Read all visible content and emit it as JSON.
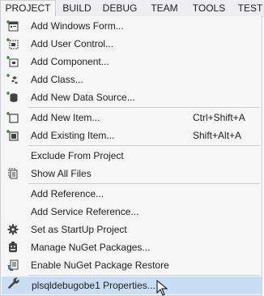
{
  "menubar": {
    "items": [
      "PROJECT",
      "BUILD",
      "DEBUG",
      "TEAM",
      "TOOLS",
      "TEST"
    ]
  },
  "menu": {
    "items": [
      {
        "label": "Add Windows Form...",
        "icon": "windows-form-icon"
      },
      {
        "label": "Add User Control...",
        "icon": "user-control-icon"
      },
      {
        "label": "Add Component...",
        "icon": "component-icon"
      },
      {
        "label": "Add Class...",
        "icon": "class-icon"
      },
      {
        "label": "Add New Data Source...",
        "icon": "data-source-icon"
      },
      {
        "label": "Add New Item...",
        "shortcut": "Ctrl+Shift+A",
        "icon": "new-item-icon"
      },
      {
        "label": "Add Existing Item...",
        "shortcut": "Shift+Alt+A",
        "icon": "existing-item-icon"
      },
      {
        "label": "Exclude From Project"
      },
      {
        "label": "Show All Files",
        "icon": "show-all-files-icon"
      },
      {
        "label": "Add Reference..."
      },
      {
        "label": "Add Service Reference..."
      },
      {
        "label": "Set as StartUp Project",
        "icon": "gear-icon"
      },
      {
        "label": "Manage NuGet Packages...",
        "icon": "nuget-icon"
      },
      {
        "label": "Enable NuGet Package Restore",
        "icon": "package-restore-icon"
      },
      {
        "label": "plsqldebugobe1 Properties...",
        "icon": "wrench-icon"
      }
    ]
  },
  "colors": {
    "menu_bg": "#f6f6f6",
    "highlight": "#c9def5",
    "separator": "#cccedb",
    "icon_green": "#388a34",
    "icon_dark": "#424242"
  }
}
